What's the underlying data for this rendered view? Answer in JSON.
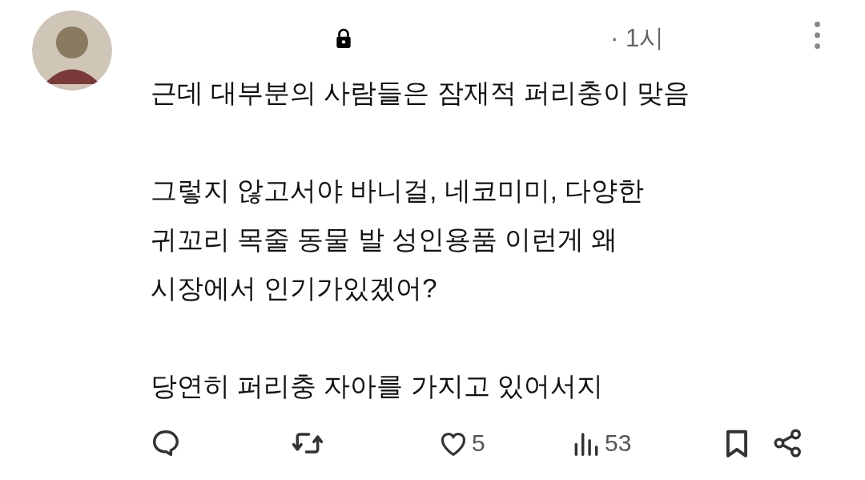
{
  "post": {
    "locked": true,
    "time": "· 1시",
    "paragraphs": [
      [
        "근데 대부분의 사람들은 잠재적 퍼리충이 맞음"
      ],
      [
        "그렇지 않고서야 바니걸, 네코미미, 다양한",
        "귀꼬리 목줄 동물 발 성인용품 이런게 왜",
        "시장에서 인기가있겠어?"
      ],
      [
        "당연히 퍼리충 자아를 가지고 있어서지"
      ]
    ],
    "actions": [
      {
        "kind": "reply"
      },
      {
        "kind": "repost"
      },
      {
        "kind": "like",
        "count": "5"
      },
      {
        "kind": "views",
        "count": "53"
      },
      {
        "kind": "bookmark"
      },
      {
        "kind": "share"
      }
    ]
  }
}
